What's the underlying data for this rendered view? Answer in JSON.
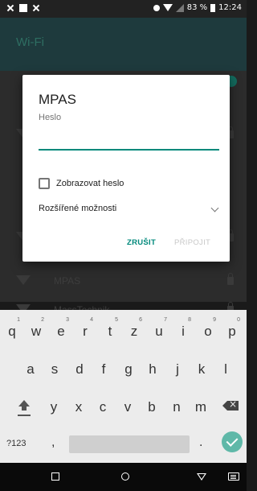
{
  "status_bar": {
    "battery_text": "83 %",
    "time": "12:24",
    "icons": [
      "close-notification-icon",
      "image-icon",
      "close-notification-icon",
      "dnd-icon",
      "wifi-icon",
      "no-signal-icon",
      "battery-icon"
    ]
  },
  "screen": {
    "title": "Wi-Fi",
    "networks": [
      {
        "name": "MPAS",
        "icon": "wifi-icon",
        "locked": true
      },
      {
        "name": "MassTechnik",
        "icon": "wifi-icon",
        "locked": true
      }
    ]
  },
  "dialog": {
    "title": "MPAS",
    "password_label": "Heslo",
    "password_value": "",
    "show_password_label": "Zobrazovat heslo",
    "show_password_checked": false,
    "advanced_label": "Rozšířené možnosti",
    "cancel_label": "ZRUŠIT",
    "connect_label": "PŘIPOJIT"
  },
  "keyboard": {
    "row1": [
      {
        "ch": "q",
        "sup": "1"
      },
      {
        "ch": "w",
        "sup": "2"
      },
      {
        "ch": "e",
        "sup": "3"
      },
      {
        "ch": "r",
        "sup": "4"
      },
      {
        "ch": "t",
        "sup": "5"
      },
      {
        "ch": "z",
        "sup": "6"
      },
      {
        "ch": "u",
        "sup": "7"
      },
      {
        "ch": "i",
        "sup": "8"
      },
      {
        "ch": "o",
        "sup": "9"
      },
      {
        "ch": "p",
        "sup": "0"
      }
    ],
    "row2": [
      "a",
      "s",
      "d",
      "f",
      "g",
      "h",
      "j",
      "k",
      "l"
    ],
    "row3": [
      "y",
      "x",
      "c",
      "v",
      "b",
      "n",
      "m"
    ],
    "symbols_label": "?123",
    "comma_label": ",",
    "period_label": "."
  },
  "colors": {
    "accent": "#00897b",
    "disabled": "#c8c8c8",
    "keyboard_bg": "#ececec",
    "done_key": "#5fb8a8"
  }
}
